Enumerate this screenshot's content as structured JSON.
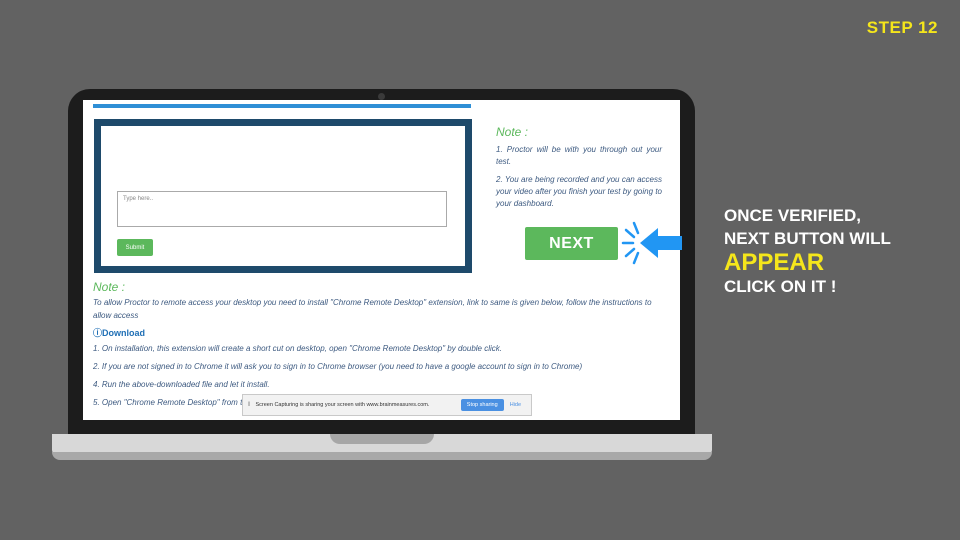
{
  "step_label": "STEP 12",
  "screen": {
    "form": {
      "textarea_placeholder": "Type here..",
      "submit_label": "Submit"
    },
    "right_note": {
      "title": "Note :",
      "items": [
        "1. Proctor will be with you through out your test.",
        "2. You are being recorded and you can access your video after you finish your test by going to your dashboard."
      ]
    },
    "next_button": "NEXT",
    "bottom_note": {
      "title": "Note :",
      "intro": "To allow Proctor to remote access your desktop you need to install \"Chrome Remote Desktop\" extension, link to same is given below, follow the instructions to allow access",
      "download_label": "Download",
      "items": [
        "1. On installation, this extension will create a short cut on desktop, open \"Chrome Remote Desktop\" by double click.",
        "2. If you are not signed in to Chrome it will ask you to sign in to Chrome browser (you need to have a google account to sign in to Chrome)",
        "4. Run the above-downloaded file and let it install.",
        "5. Open \"Chrome Remote Desktop\" from                                                                          to share with Proctor to allowaccess."
      ]
    },
    "share_bar": {
      "message": "Screen Capturing is sharing your screen with www.brainmeasures.com.",
      "stop_label": "Stop sharing",
      "hide_label": "Hide"
    }
  },
  "callout": {
    "line1": "ONCE VERIFIED,",
    "line2": "NEXT BUTTON WILL",
    "line3": "APPEAR",
    "line4": "CLICK ON IT !"
  },
  "colors": {
    "background": "#626262",
    "accent_yellow": "#f5e61b",
    "button_green": "#5cb85c",
    "arrow_blue": "#2196f3"
  }
}
